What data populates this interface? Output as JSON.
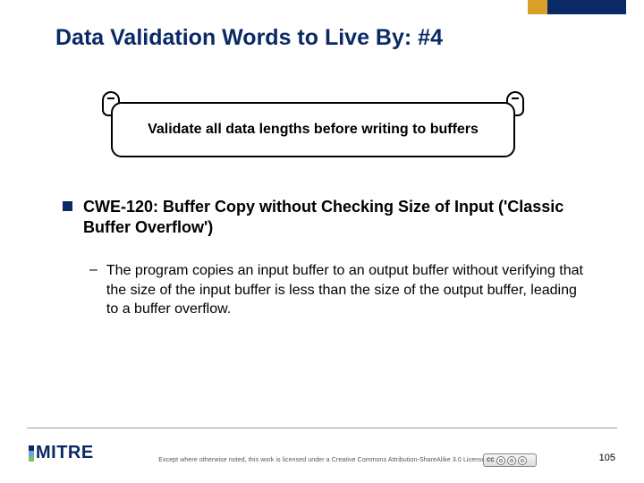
{
  "title": "Data Validation Words to Live By: #4",
  "callout": "Validate all data lengths before writing to buffers",
  "bullet": {
    "heading": "CWE-120: Buffer Copy without Checking Size of Input ('Classic Buffer Overflow')",
    "sub": "The program copies an input buffer to an output buffer without verifying that the size of the input buffer is less than the size of the output buffer, leading to a buffer overflow."
  },
  "footer": {
    "logo": "MITRE",
    "license": "Except where otherwise noted, this work is licensed under a Creative Commons Attribution-ShareAlike 3.0 License",
    "cc_label": "CC",
    "page": "105"
  },
  "colors": {
    "navy": "#0a2a66",
    "gold": "#d8a028"
  }
}
